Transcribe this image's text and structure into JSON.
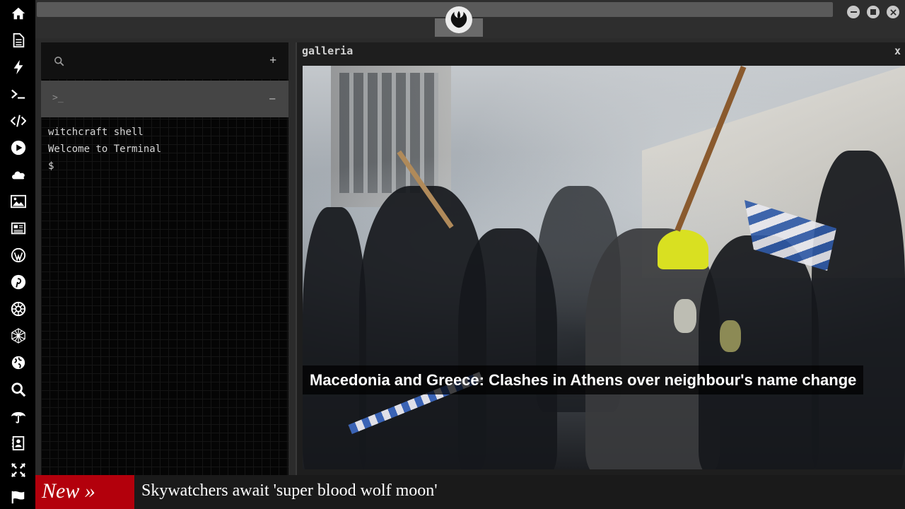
{
  "sidebar": {
    "icons": [
      "home-icon",
      "document-icon",
      "bolt-icon",
      "terminal-icon",
      "code-icon",
      "play-icon",
      "cloud-icon",
      "image-icon",
      "newspaper-icon",
      "wordpress-icon",
      "pinterest-icon",
      "empire-icon",
      "network-icon",
      "globe-icon",
      "search-icon",
      "umbrella-icon",
      "contact-icon",
      "expand-icon",
      "flag-icon"
    ]
  },
  "topbar": {
    "logo": "rebel-alliance-icon",
    "window_buttons": [
      "minimize-icon",
      "maximize-icon",
      "close-icon"
    ]
  },
  "terminal": {
    "search_icon": "search-icon",
    "add_symbol": "+",
    "prompt_symbol": ">_",
    "collapse_symbol": "−",
    "lines": [
      "witchcraft shell",
      "Welcome to Terminal",
      "$"
    ]
  },
  "gallery": {
    "title": "galleria",
    "close_label": "x",
    "caption": "Macedonia and Greece: Clashes in Athens over neighbour's name change"
  },
  "ticker": {
    "badge": "New »",
    "headline": "Skywatchers await 'super blood wolf moon'"
  },
  "colors": {
    "rail_bg": "#000000",
    "topbar_bg": "#2e2e2e",
    "badge_red": "#b3000c",
    "terminal_bg": "#050505"
  }
}
